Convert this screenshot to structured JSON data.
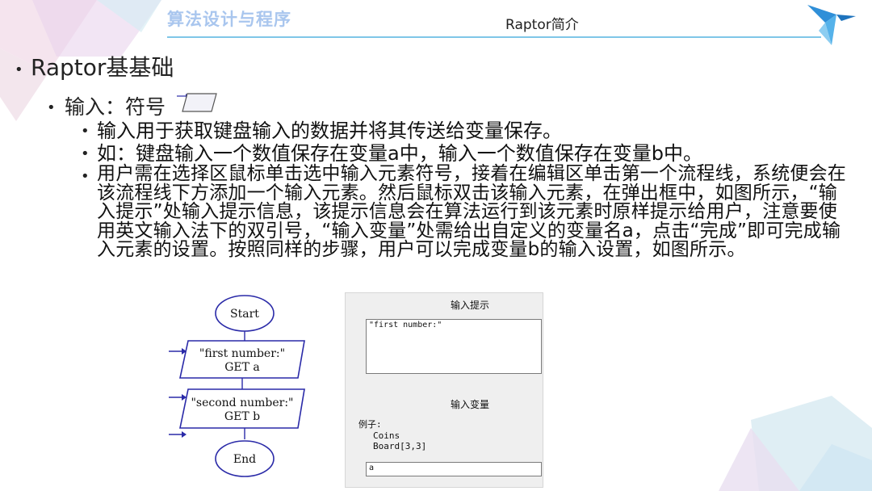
{
  "header": {
    "course_title": "算法设计与程序",
    "slide_subtitle": "Raptor简介"
  },
  "content": {
    "level1": "Raptor基基础",
    "level2": "输入：符号",
    "items": [
      "输入用于获取键盘输入的数据并将其传送给变量保存。",
      "如：键盘输入一个数值保存在变量a中，输入一个数值保存在变量b中。"
    ],
    "paragraph": "用户需在选择区鼠标单击选中输入元素符号，接着在编辑区单击第一个流程线，系统便会在该流程线下方添加一个输入元素。然后鼠标双击该输入元素，在弹出框中，如图所示，“输入提示”处输入提示信息，该提示信息会在算法运行到该元素时原样提示给用户，注意要使用英文输入法下的双引号，“输入变量”处需给出自定义的变量名a，点击“完成”即可完成输入元素的设置。按照同样的步骤，用户可以完成变量b的输入设置，如图所示。"
  },
  "flowchart": {
    "start": "Start",
    "input1_prompt": "\"first number:\"",
    "input1_get": "GET a",
    "input2_prompt": "\"second number:\"",
    "input2_get": "GET b",
    "end": "End"
  },
  "dialog": {
    "prompt_title": "输入提示",
    "prompt_value": "\"first number:\"",
    "variable_title": "输入变量",
    "example_label": "例子:",
    "example_1": "Coins",
    "example_2": "Board[3,3]",
    "variable_value": "a"
  },
  "colors": {
    "accent_blue": "#7fc6e8",
    "flow_stroke": "#2a2aa8",
    "title_blue": "#a9c6ee"
  }
}
